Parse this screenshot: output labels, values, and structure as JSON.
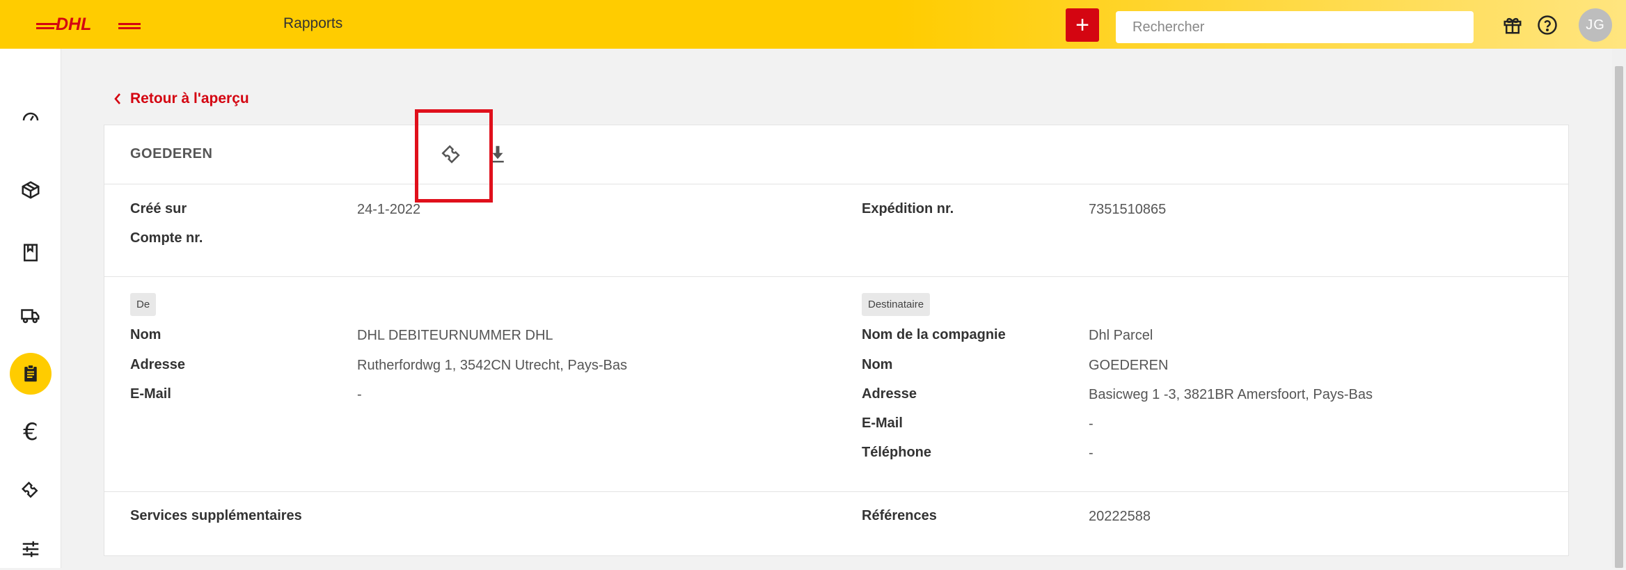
{
  "header": {
    "logo_text": "DHL",
    "nav_link": "Rapports",
    "add_label": "+",
    "search_placeholder": "Rechercher",
    "avatar_initials": "JG"
  },
  "sidebar": {
    "items": [
      {
        "icon": "gauge-icon"
      },
      {
        "icon": "package-icon"
      },
      {
        "icon": "bookmark-icon"
      },
      {
        "icon": "truck-icon"
      },
      {
        "icon": "clipboard-icon",
        "active": true
      },
      {
        "icon": "euro-icon",
        "glyph": "€"
      },
      {
        "icon": "ticket-icon"
      },
      {
        "icon": "sliders-icon"
      }
    ]
  },
  "back_link": "Retour à l'aperçu",
  "card": {
    "title": "GOEDEREN",
    "header_icons": [
      "ticket-icon",
      "download-icon"
    ],
    "details": {
      "created_label": "Créé sur",
      "created_value": "24-1-2022",
      "account_label": "Compte nr.",
      "shipment_label": "Expédition nr.",
      "shipment_value": "7351510865"
    },
    "from": {
      "tag": "De",
      "rows": [
        {
          "label": "Nom",
          "value": "DHL DEBITEURNUMMER DHL"
        },
        {
          "label": "Adresse",
          "value": "Rutherfordwg 1, 3542CN Utrecht, Pays-Bas"
        },
        {
          "label": "E-Mail",
          "value": "-"
        }
      ]
    },
    "to": {
      "tag": "Destinataire",
      "rows": [
        {
          "label": "Nom de la compagnie",
          "value": "Dhl Parcel"
        },
        {
          "label": "Nom",
          "value": "GOEDEREN"
        },
        {
          "label": "Adresse",
          "value": "Basicweg 1 -3, 3821BR Amersfoort, Pays-Bas"
        },
        {
          "label": "E-Mail",
          "value": "-"
        },
        {
          "label": "Téléphone",
          "value": "-"
        }
      ]
    },
    "extra": {
      "services_label": "Services supplémentaires",
      "references_label": "Références",
      "references_value": "20222588"
    }
  },
  "colors": {
    "brand_yellow": "#ffcc00",
    "brand_red": "#d40511",
    "highlight_red": "#e0101c"
  }
}
